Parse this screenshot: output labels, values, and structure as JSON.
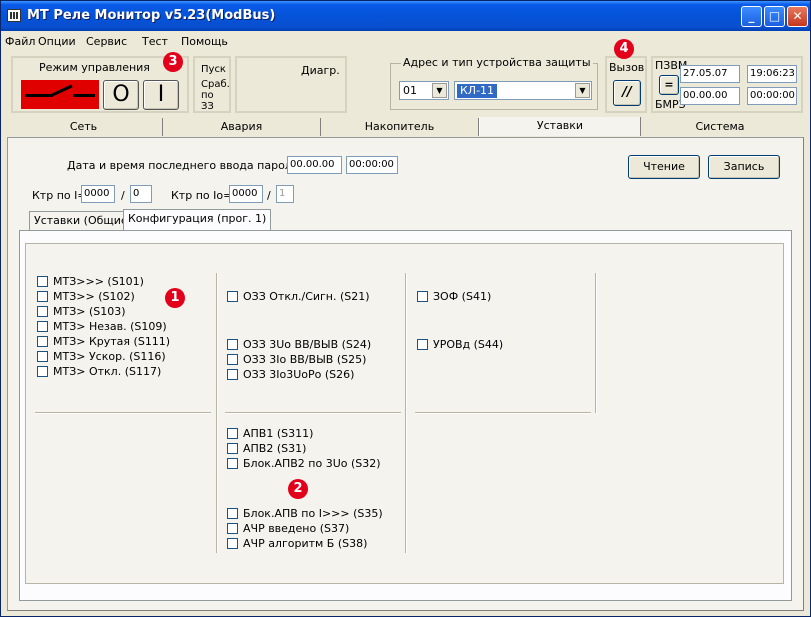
{
  "window": {
    "title": "МТ Реле Монитор v5.23(ModBus)"
  },
  "menu": [
    "Файл",
    "Опции",
    "Сервис",
    "Тест",
    "Помощь"
  ],
  "control": {
    "mode_label": "Режим управления",
    "off_symbol": "O",
    "on_symbol": "I",
    "pusk_line1": "Пуск",
    "srab_line1": "Сраб.",
    "srab_line2": "по ЗЗ",
    "diag_label": "Диагр."
  },
  "device": {
    "group_label": "Адрес и тип устройства защиты",
    "address": "01",
    "type": "КЛ-11"
  },
  "call": {
    "label": "Вызов",
    "icon": "//"
  },
  "time": {
    "pc_label": "ПЗВМ",
    "bmrz_label": "БМРЗ",
    "sep": "=",
    "pc_date": "27.05.07",
    "pc_time": "19:06:23",
    "bmrz_date": "00.00.00",
    "bmrz_time": "00:00:00"
  },
  "tabs": [
    "Сеть",
    "Авария",
    "Накопитель",
    "Уставки",
    "Система"
  ],
  "password": {
    "label": "Дата и время последнего ввода пароля",
    "date": "00.00.00",
    "time": "00:00:00"
  },
  "ktr": {
    "i_label": "Ктр по I=",
    "i_value": "0000",
    "i_sep": "/",
    "i_div": "0",
    "io_label": "Ктр по Io=",
    "io_value": "0000",
    "io_sep": "/",
    "io_div": "1"
  },
  "buttons": {
    "read": "Чтение",
    "write": "Запись"
  },
  "subtabs": [
    "Уставки (Общие)",
    "Конфигурация (прог. 1)"
  ],
  "col1": [
    "МТЗ>>> (S101)",
    "МТЗ>>  (S102)",
    "МТЗ>   (S103)",
    "МТЗ> Незав. (S109)",
    "МТЗ> Крутая (S111)",
    "МТЗ> Ускор. (S116)",
    "МТЗ> Откл. (S117)"
  ],
  "col2a": [
    "ОЗЗ Откл./Сигн. (S21)"
  ],
  "col2b": [
    "ОЗЗ 3Uo ВВ/ВЫВ (S24)",
    "ОЗЗ 3Io ВВ/ВЫВ (S25)",
    "ОЗЗ 3Io3UoРо (S26)"
  ],
  "col2c": [
    "АПВ1 (S311)",
    "АПВ2 (S31)",
    "Блок.АПВ2 по 3Uo (S32)"
  ],
  "col2d": [
    "Блок.АПВ по I>>> (S35)",
    "АЧР введено (S37)",
    "АЧР алгоритм Б (S38)"
  ],
  "col3a": [
    "ЗОФ (S41)"
  ],
  "col3b": [
    "УРОВд (S44)"
  ],
  "badges": {
    "b1": "1",
    "b2": "2",
    "b3": "3",
    "b4": "4"
  },
  "colors": {
    "title": "#0553d8",
    "badge": "#e3001b",
    "selection": "#316ac5"
  }
}
